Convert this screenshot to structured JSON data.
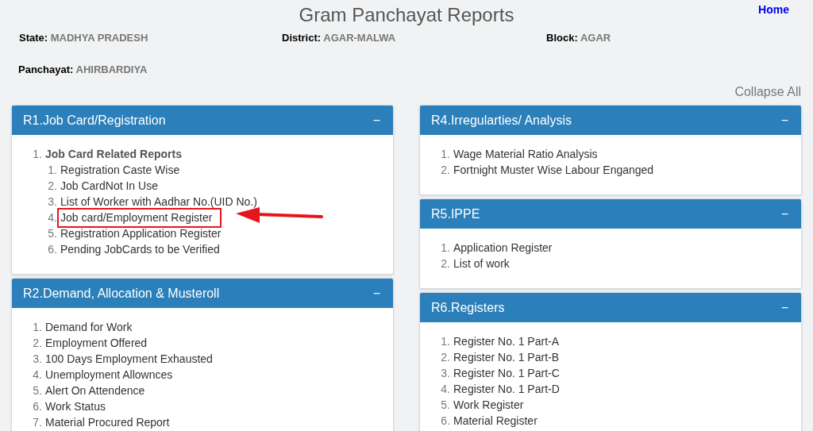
{
  "title": "Gram Panchayat Reports",
  "home_link": "Home",
  "info": [
    {
      "label": "State:",
      "value": "MADHYA PRADESH"
    },
    {
      "label": "District:",
      "value": "AGAR-MALWA"
    },
    {
      "label": "Block:",
      "value": "AGAR"
    },
    {
      "label": "Panchayat:",
      "value": "AHIRBARDIYA"
    }
  ],
  "collapse_all": "Collapse All",
  "columns": [
    {
      "panels": [
        {
          "title": "R1.Job Card/Registration",
          "toggle": "−",
          "items": [
            {
              "number": "1.",
              "label": "Job Card Related Reports",
              "highlighted": false,
              "children": [
                {
                  "number": "1.",
                  "label": "Registration Caste Wise",
                  "highlighted": false
                },
                {
                  "number": "2.",
                  "label": "Job CardNot In Use",
                  "highlighted": false
                },
                {
                  "number": "3.",
                  "label": "List of Worker with Aadhar No.(UID No.)",
                  "highlighted": false
                },
                {
                  "number": "4.",
                  "label": "Job card/Employment Register",
                  "highlighted": true
                },
                {
                  "number": "5.",
                  "label": "Registration Application Register",
                  "highlighted": false
                },
                {
                  "number": "6.",
                  "label": "Pending JobCards to be Verified",
                  "highlighted": false
                }
              ]
            }
          ]
        },
        {
          "title": "R2.Demand, Allocation & Musteroll",
          "toggle": "−",
          "items": [
            {
              "number": "1.",
              "label": "Demand for Work",
              "highlighted": false
            },
            {
              "number": "2.",
              "label": "Employment Offered",
              "highlighted": false
            },
            {
              "number": "3.",
              "label": "100 Days Employment Exhausted",
              "highlighted": false
            },
            {
              "number": "4.",
              "label": "Unemployment Allownces",
              "highlighted": false
            },
            {
              "number": "5.",
              "label": "Alert On Attendence",
              "highlighted": false
            },
            {
              "number": "6.",
              "label": "Work Status",
              "highlighted": false
            },
            {
              "number": "7.",
              "label": "Material Procured Report",
              "highlighted": false
            }
          ]
        }
      ]
    },
    {
      "panels": [
        {
          "title": "R4.Irregularties/ Analysis",
          "toggle": "−",
          "items": [
            {
              "number": "1.",
              "label": "Wage Material Ratio Analysis",
              "highlighted": false
            },
            {
              "number": "2.",
              "label": "Fortnight Muster Wise Labour Enganged",
              "highlighted": false
            }
          ]
        },
        {
          "title": "R5.IPPE",
          "toggle": "−",
          "items": [
            {
              "number": "1.",
              "label": "Application Register",
              "highlighted": false
            },
            {
              "number": "2.",
              "label": "List of work",
              "highlighted": false
            }
          ]
        },
        {
          "title": "R6.Registers",
          "toggle": "−",
          "items": [
            {
              "number": "1.",
              "label": "Register No. 1 Part-A",
              "highlighted": false
            },
            {
              "number": "2.",
              "label": "Register No. 1 Part-B",
              "highlighted": false
            },
            {
              "number": "3.",
              "label": "Register No. 1 Part-C",
              "highlighted": false
            },
            {
              "number": "4.",
              "label": "Register No. 1 Part-D",
              "highlighted": false
            },
            {
              "number": "5.",
              "label": "Work Register",
              "highlighted": false
            },
            {
              "number": "6.",
              "label": "Material Register",
              "highlighted": false
            }
          ]
        }
      ]
    }
  ]
}
